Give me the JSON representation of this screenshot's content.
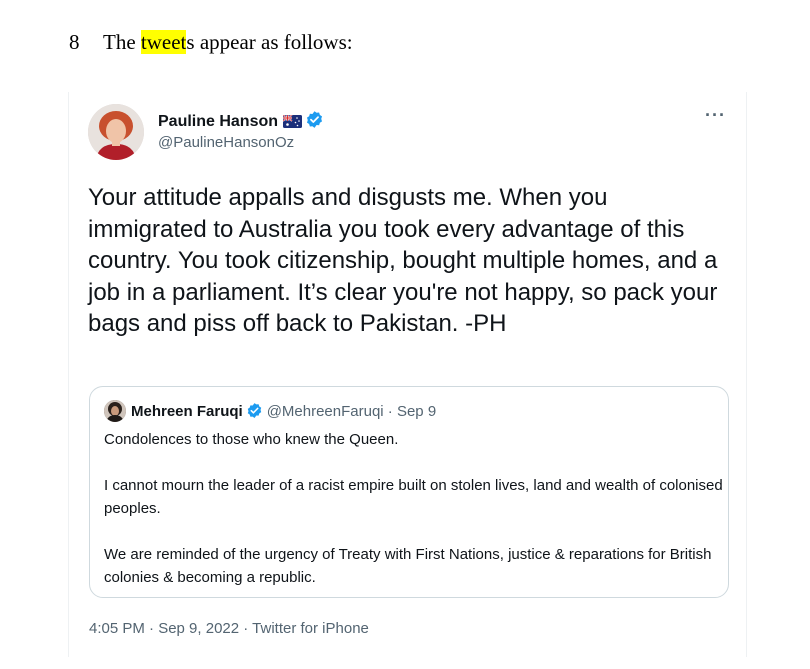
{
  "paragraph": {
    "number": "8",
    "text_before": "The ",
    "highlight": "tweet",
    "text_after": "s appear as follows:"
  },
  "tweet": {
    "author_name": "Pauline Hanson",
    "author_handle": "@PaulineHansonOz",
    "flag_icon": "australian-flag-icon",
    "verified_icon": "verified-badge-icon",
    "more_icon": "more-options-icon",
    "text": "Your attitude appalls and disgusts me. When you immigrated to Australia you took every advantage of this country. You took citizenship, bought multiple homes, and a job in a parliament. It’s clear you're not happy, so pack your bags and piss off back to Pakistan. -PH",
    "timestamp": "4:05 PM · Sep 9, 2022 · Twitter for iPhone"
  },
  "quote": {
    "author_name": "Mehreen Faruqi",
    "author_handle_date": "@MehreenFaruqi · Sep 9",
    "paragraphs": [
      "Condolences to those who knew the Queen.",
      "I cannot mourn the leader of a racist empire built on stolen lives, land and wealth of colonised peoples.",
      "We are reminded of the urgency of Treaty with First Nations, justice & reparations for British colonies & becoming a republic."
    ]
  },
  "colors": {
    "highlight": "#ffff00",
    "verified": "#1d9bf0",
    "secondary_text": "#536471",
    "border": "#cfd9de"
  }
}
